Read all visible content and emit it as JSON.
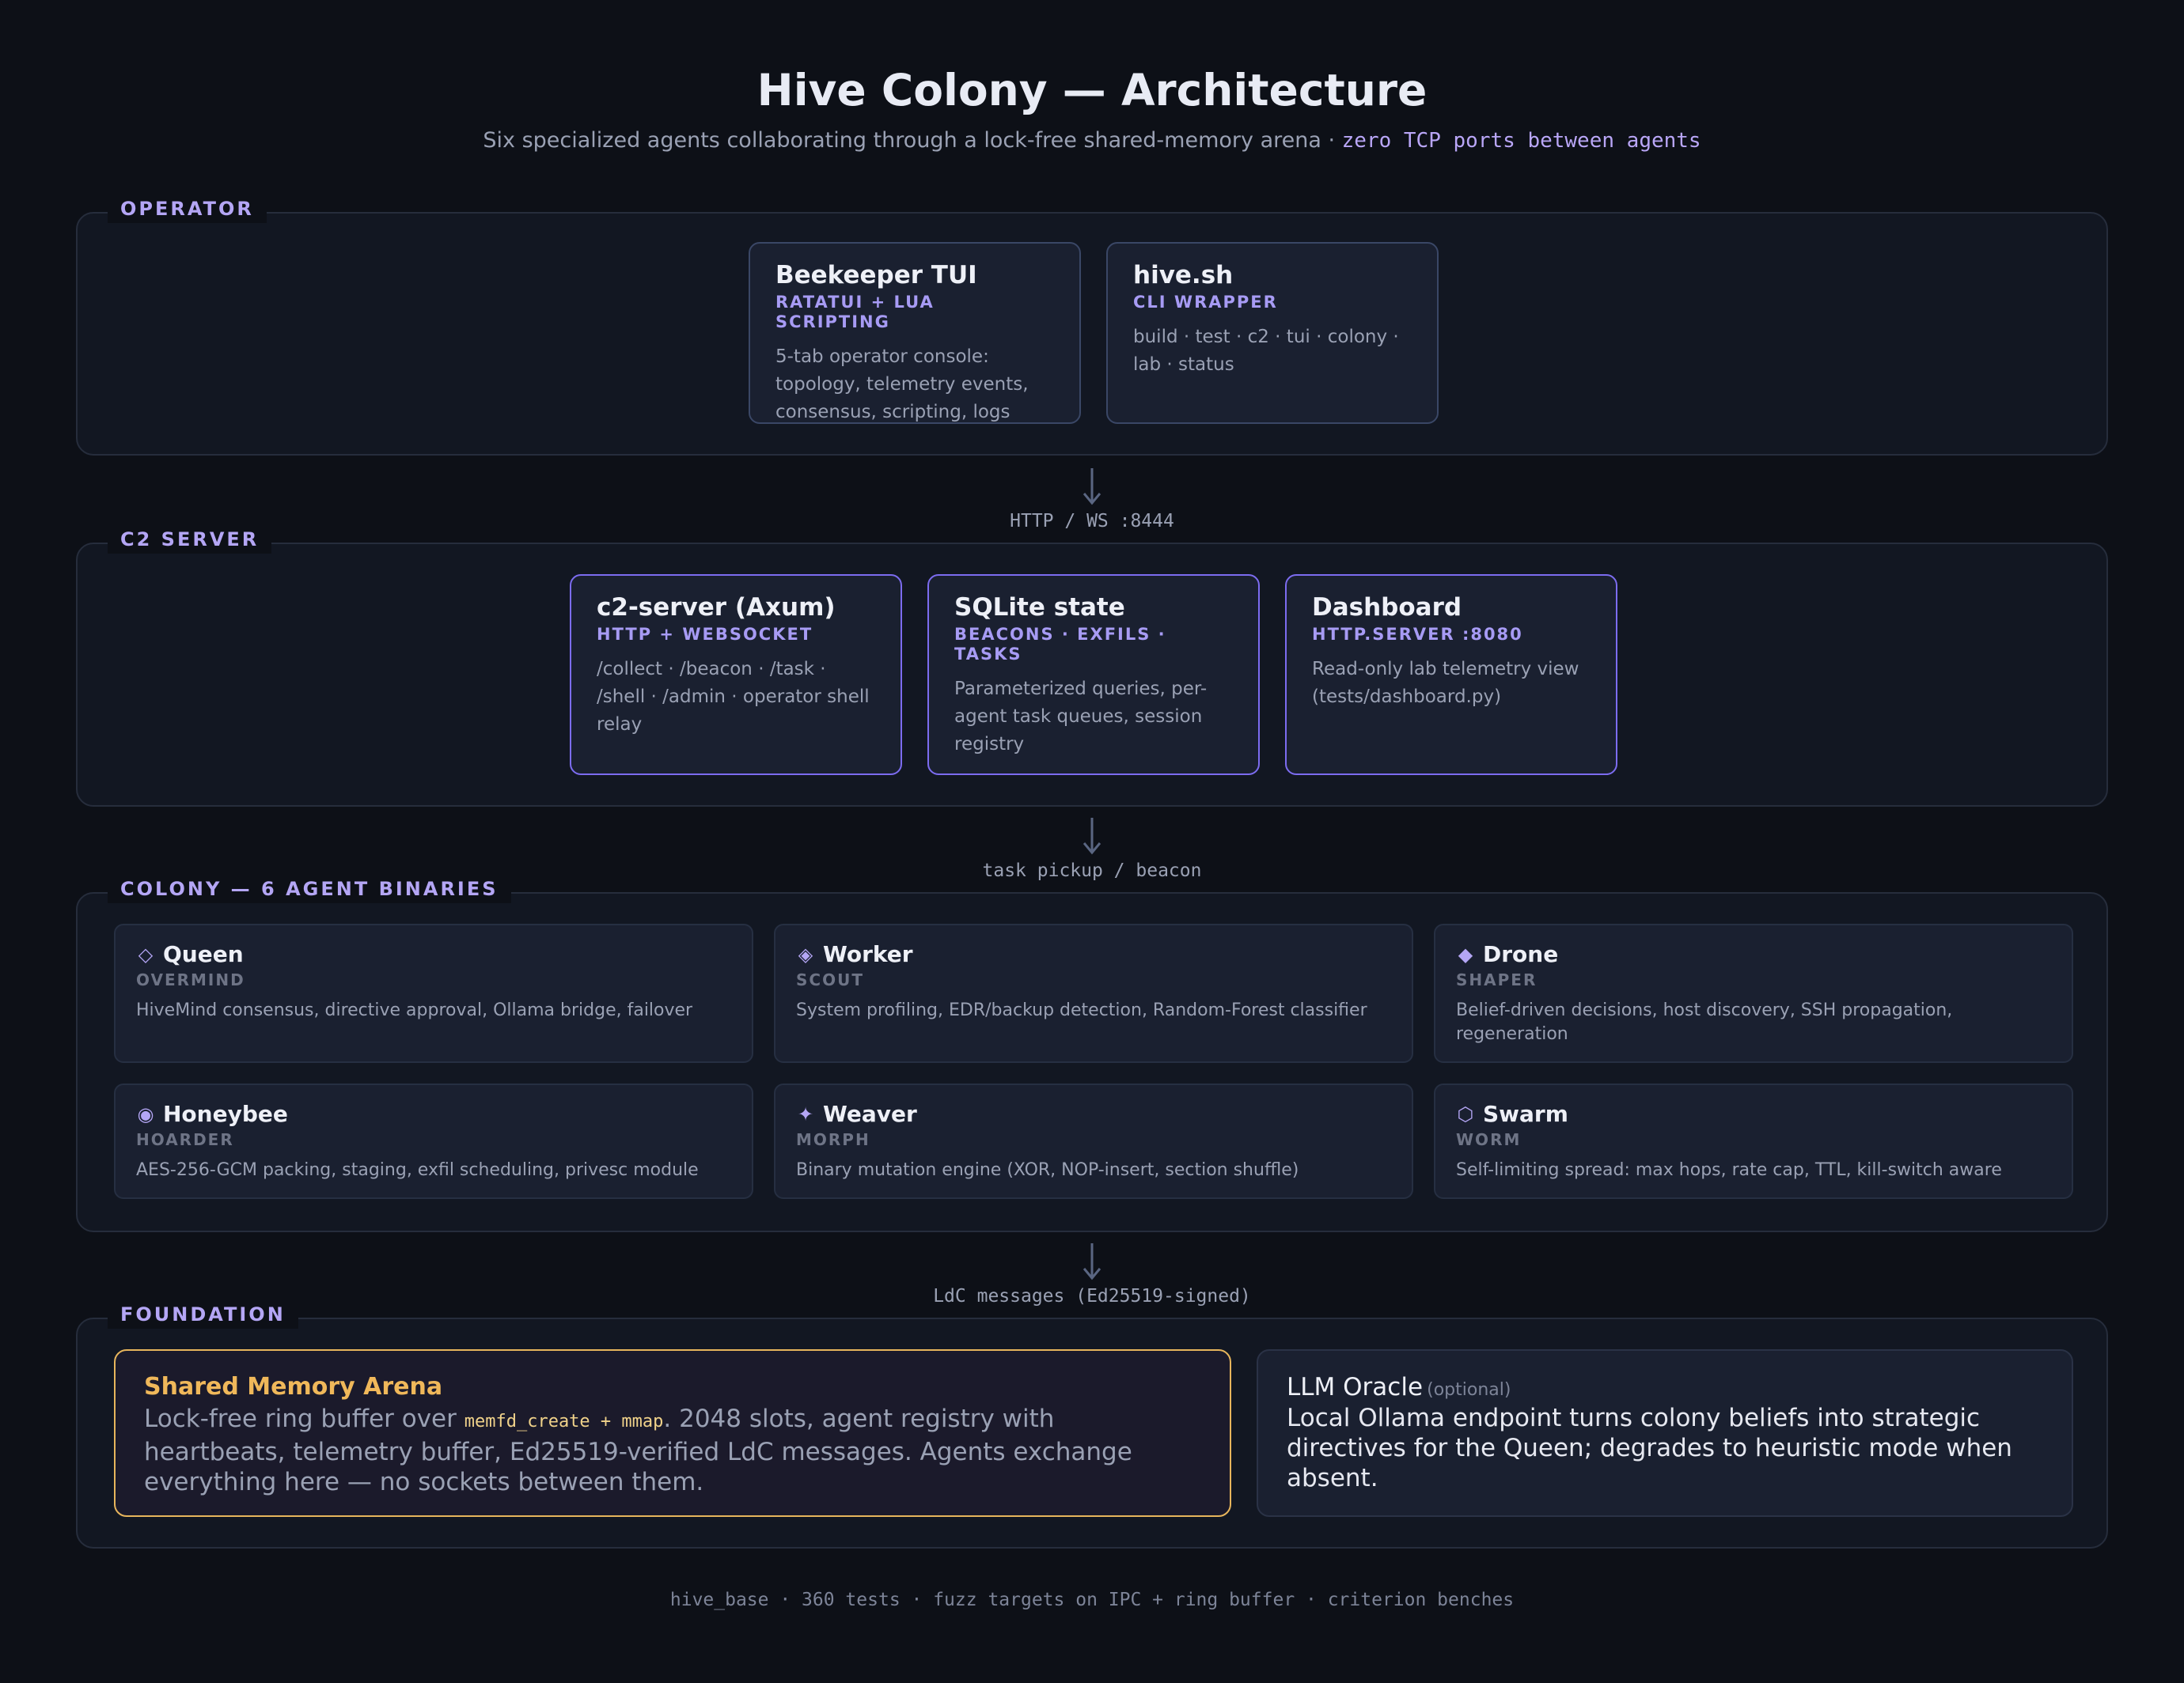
{
  "header": {
    "title": "Hive Colony — Architecture",
    "subtitle_text": "Six specialized agents collaborating through a lock-free shared-memory arena · ",
    "subtitle_mono": "zero TCP ports between agents"
  },
  "operator": {
    "label": "OPERATOR",
    "cards": [
      {
        "title": "Beekeeper TUI",
        "subtitle": "RATATUI + LUA SCRIPTING",
        "desc": "5-tab operator console: topology, telemetry events, consensus, scripting, logs"
      },
      {
        "title": "hive.sh",
        "subtitle": "CLI WRAPPER",
        "desc": "build · test · c2 · tui · colony · lab · status"
      }
    ]
  },
  "connectors": [
    "HTTP / WS :8444",
    "task pickup / beacon",
    "LdC messages (Ed25519-signed)"
  ],
  "c2": {
    "label": "C2 SERVER",
    "cards": [
      {
        "title": "c2-server (Axum)",
        "subtitle": "HTTP + WEBSOCKET",
        "desc": "/collect · /beacon · /task · /shell · /admin · operator shell relay"
      },
      {
        "title": "SQLite state",
        "subtitle": "BEACONS · EXFILS · TASKS",
        "desc": "Parameterized queries, per-agent task queues, session registry"
      },
      {
        "title": "Dashboard",
        "subtitle": "HTTP.SERVER :8080",
        "desc": "Read-only lab telemetry view (tests/dashboard.py)"
      }
    ]
  },
  "colony": {
    "label": "COLONY — 6 AGENT BINARIES",
    "agents": [
      {
        "icon": "◇",
        "icon_name": "diamond-outline-icon",
        "name": "Queen",
        "role": "OVERMIND",
        "desc": "HiveMind consensus, directive approval, Ollama bridge, failover"
      },
      {
        "icon": "◈",
        "icon_name": "diamond-dot-icon",
        "name": "Worker",
        "role": "SCOUT",
        "desc": "System profiling, EDR/backup detection, Random-Forest classifier"
      },
      {
        "icon": "◆",
        "icon_name": "diamond-filled-icon",
        "name": "Drone",
        "role": "SHAPER",
        "desc": "Belief-driven decisions, host discovery, SSH propagation, regeneration"
      },
      {
        "icon": "◉",
        "icon_name": "fisheye-icon",
        "name": "Honeybee",
        "role": "HOARDER",
        "desc": "AES-256-GCM packing, staging, exfil scheduling, privesc module"
      },
      {
        "icon": "✦",
        "icon_name": "sparkle-icon",
        "name": "Weaver",
        "role": "MORPH",
        "desc": "Binary mutation engine (XOR, NOP-insert, section shuffle)"
      },
      {
        "icon": "⬡",
        "icon_name": "hexagon-icon",
        "name": "Swarm",
        "role": "WORM",
        "desc": "Self-limiting spread: max hops, rate cap, TTL, kill-switch aware"
      }
    ]
  },
  "foundation": {
    "label": "FOUNDATION",
    "arena": {
      "title": "Shared Memory Arena",
      "desc_pre": "Lock-free ring buffer over ",
      "desc_mono": "memfd_create + mmap",
      "desc_post": ". 2048 slots, agent registry with heartbeats, telemetry buffer, Ed25519-verified LdC messages. Agents exchange everything here — no sockets between them."
    },
    "oracle": {
      "title": "LLM Oracle",
      "optional": "(optional)",
      "desc": "Local Ollama endpoint turns colony beliefs into strategic directives for the Queen; degrades to heuristic mode when absent."
    }
  },
  "footer": "hive_base · 360 tests · fuzz targets on IPC + ring buffer · criterion benches",
  "colors": {
    "background": "#0d1017",
    "accent": "#b4a6f5",
    "arena_border": "#e7b55c",
    "card_border_purple": "#7c6cf0"
  }
}
